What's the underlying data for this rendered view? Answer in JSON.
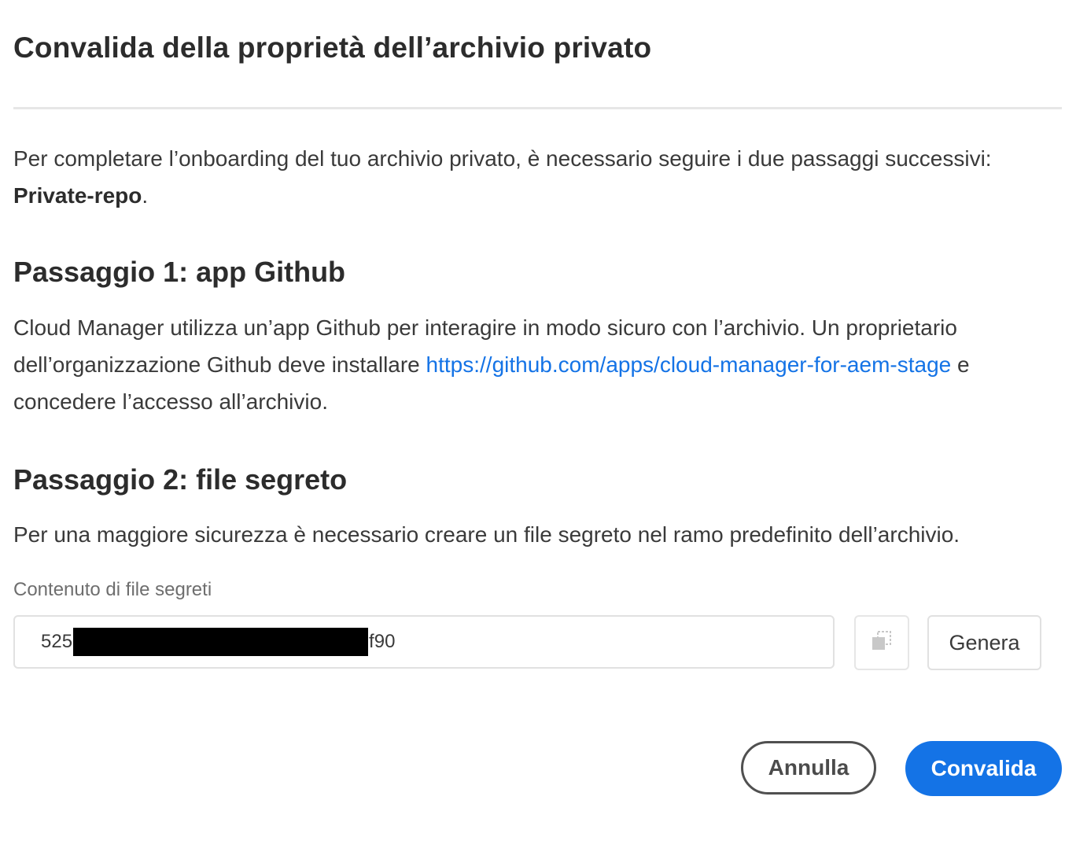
{
  "dialog": {
    "title": "Convalida della proprietà dell’archivio privato",
    "intro": {
      "text": "Per completare l’onboarding del tuo archivio privato, è necessario seguire i due passaggi successivi: ",
      "repo_name": "Private-repo",
      "suffix": "."
    },
    "step1": {
      "heading": "Passaggio 1: app Github",
      "text_before": "Cloud Manager utilizza un’app Github per interagire in modo sicuro con l’archivio. Un proprietario dell’organizzazione Github deve installare ",
      "link": "https://github.com/apps/cloud-manager-for-aem-stage",
      "text_after": " e concedere l’accesso all’archivio."
    },
    "step2": {
      "heading": "Passaggio 2: file segreto",
      "text": "Per una maggiore sicurezza è necessario creare un file segreto nel ramo predefinito dell’archivio."
    },
    "secret_field": {
      "label": "Contenuto di file segreti",
      "value_prefix": "525",
      "value_suffix": "f90",
      "copy_icon": "copy-icon"
    },
    "buttons": {
      "generate": "Genera",
      "cancel": "Annulla",
      "confirm": "Convalida"
    },
    "colors": {
      "accent": "#1473e6",
      "text": "#2c2c2c",
      "muted": "#6e6e6e"
    }
  }
}
